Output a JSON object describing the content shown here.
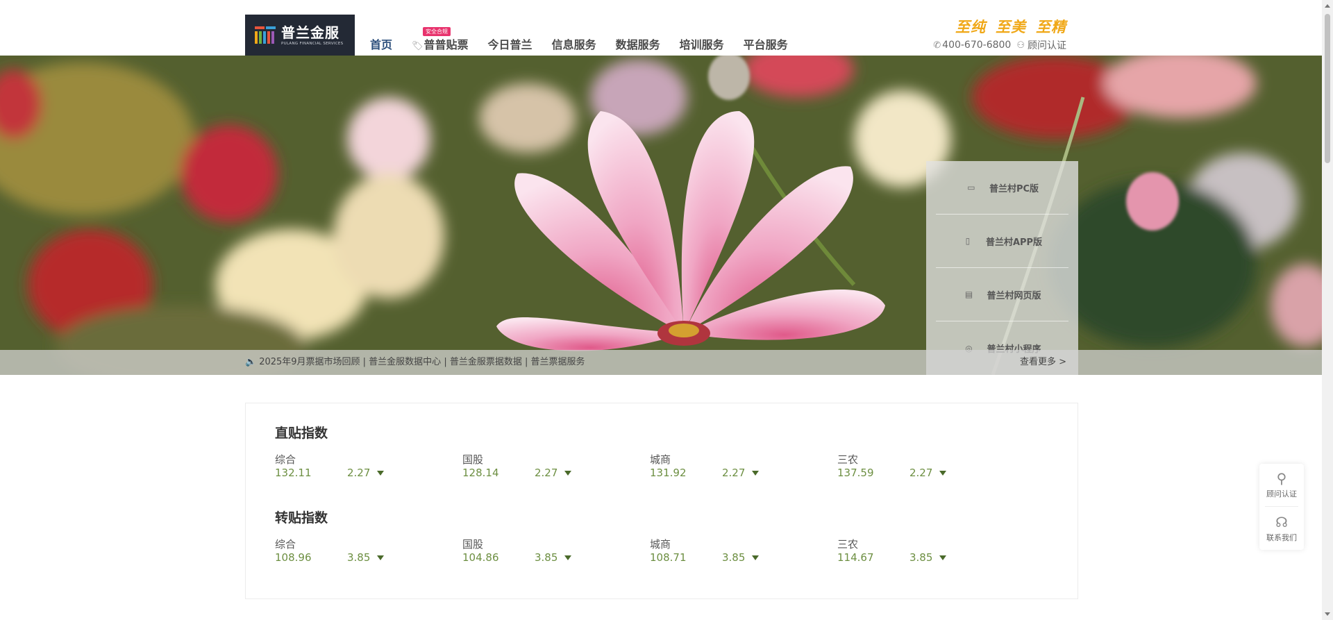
{
  "brand": {
    "logo_title": "普兰金服",
    "logo_subtitle": "PULANG FINANCIAL SERVICES",
    "colors": {
      "logo_bg": "#232935",
      "accent_orange": "#f0a818",
      "nav_active": "#2a4d7a",
      "badge_pink": "#e8336d",
      "index_green": "#6d8f42"
    }
  },
  "nav": {
    "items": [
      {
        "label": "首页",
        "active": true
      },
      {
        "label": "普普贴票",
        "badge": "安全合规",
        "icon": "ticket-icon"
      },
      {
        "label": "今日普兰"
      },
      {
        "label": "信息服务"
      },
      {
        "label": "数据服务"
      },
      {
        "label": "培训服务"
      },
      {
        "label": "平台服务"
      }
    ]
  },
  "slogan": [
    "至纯",
    "至美",
    "至精"
  ],
  "contact": {
    "phone": "400-670-6800",
    "consultant": "顾问认证"
  },
  "banner": {
    "side_menu": [
      {
        "label": "普兰村PC版",
        "icon": "monitor-icon"
      },
      {
        "label": "普兰村APP版",
        "icon": "tablet-icon"
      },
      {
        "label": "普兰村网页版",
        "icon": "browser-icon"
      },
      {
        "label": "普兰村小程序",
        "icon": "mini-program-icon"
      }
    ],
    "notice": "2025年9月票据市场回顾 | 普兰金服数据中心 | 普兰金服票据数据 | 普兰票据服务",
    "more": "查看更多 >"
  },
  "indices": [
    {
      "title": "直贴指数",
      "items": [
        {
          "name": "综合",
          "value": "132.11",
          "change": "2.27",
          "direction": "down"
        },
        {
          "name": "国股",
          "value": "128.14",
          "change": "2.27",
          "direction": "down"
        },
        {
          "name": "城商",
          "value": "131.92",
          "change": "2.27",
          "direction": "down"
        },
        {
          "name": "三农",
          "value": "137.59",
          "change": "2.27",
          "direction": "down"
        }
      ]
    },
    {
      "title": "转贴指数",
      "items": [
        {
          "name": "综合",
          "value": "108.96",
          "change": "3.85",
          "direction": "down"
        },
        {
          "name": "国股",
          "value": "104.86",
          "change": "3.85",
          "direction": "down"
        },
        {
          "name": "城商",
          "value": "108.71",
          "change": "3.85",
          "direction": "down"
        },
        {
          "name": "三农",
          "value": "114.67",
          "change": "3.85",
          "direction": "down"
        }
      ]
    }
  ],
  "float": {
    "consultant": "顾问认证",
    "contact_us": "联系我们"
  }
}
